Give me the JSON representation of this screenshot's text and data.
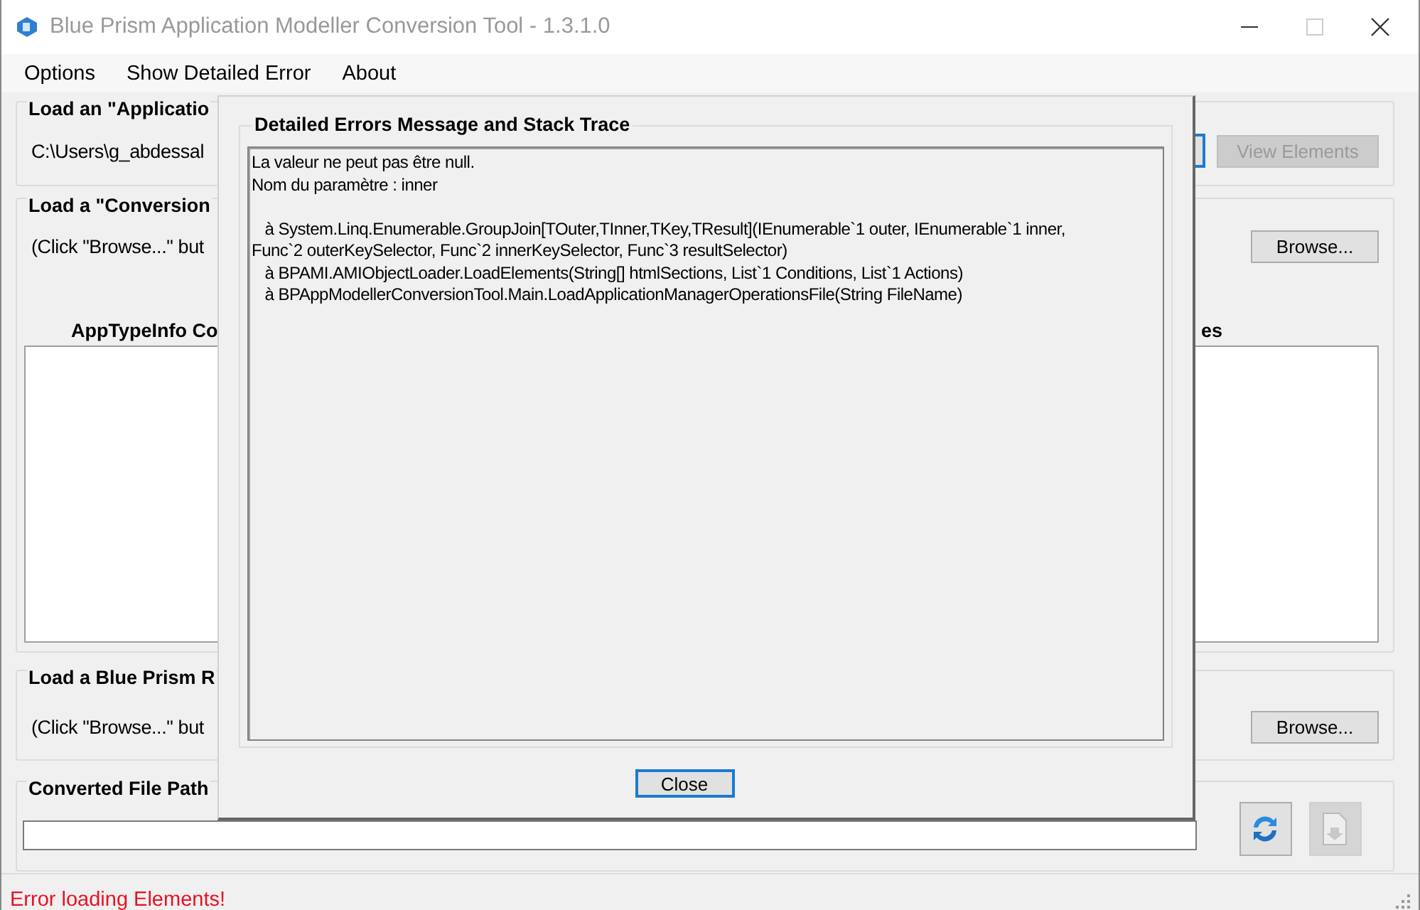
{
  "window": {
    "title": "Blue Prism Application Modeller Conversion Tool - 1.3.1.0"
  },
  "menu": [
    "Options",
    "Show Detailed Error",
    "About"
  ],
  "application_group": {
    "legend": "Load an \"Applicatio",
    "path": "C:\\Users\\g_abdessal",
    "view_button": {
      "label": "View Elements",
      "disabled": true
    }
  },
  "conversion_group": {
    "legend": "Load a \"Conversion",
    "hint": "(Click \"Browse...\" but",
    "browse_button": "Browse...",
    "left_list_header": "AppTypeInfo Co",
    "right_list_header": "es"
  },
  "blueprism_group": {
    "legend": "Load a Blue Prism R",
    "hint": "(Click \"Browse...\" but",
    "browse_button": "Browse..."
  },
  "output_group": {
    "legend": "Converted File Path",
    "save_button": {
      "disabled": true
    }
  },
  "status_bar": {
    "message": "Error loading Elements!"
  },
  "dialog": {
    "group_title": "Detailed Errors Message and Stack Trace",
    "message": "La valeur ne peut pas être null.\nNom du paramètre : inner\n\n   à System.Linq.Enumerable.GroupJoin[TOuter,TInner,TKey,TResult](IEnumerable`1 outer, IEnumerable`1 inner,\nFunc`2 outerKeySelector, Func`2 innerKeySelector, Func`3 resultSelector)\n   à BPAMI.AMIObjectLoader.LoadElements(String[] htmlSections, List`1 Conditions, List`1 Actions)\n   à BPAppModellerConversionTool.Main.LoadApplicationManagerOperationsFile(String FileName)",
    "close_button": "Close"
  }
}
